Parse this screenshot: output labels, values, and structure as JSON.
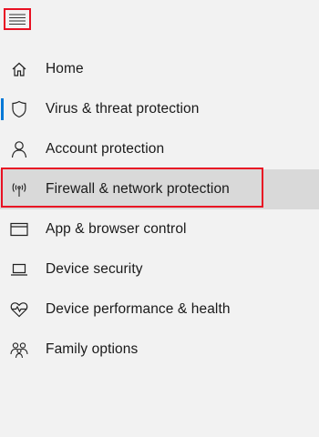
{
  "header": {
    "menu_icon": "hamburger-menu-icon"
  },
  "nav": {
    "items": [
      {
        "label": "Home",
        "icon": "home-icon"
      },
      {
        "label": "Virus & threat protection",
        "icon": "shield-icon"
      },
      {
        "label": "Account protection",
        "icon": "person-icon"
      },
      {
        "label": "Firewall & network protection",
        "icon": "antenna-icon"
      },
      {
        "label": "App & browser control",
        "icon": "app-window-icon"
      },
      {
        "label": "Device security",
        "icon": "laptop-icon"
      },
      {
        "label": "Device performance & health",
        "icon": "heart-pulse-icon"
      },
      {
        "label": "Family options",
        "icon": "family-icon"
      }
    ]
  },
  "colors": {
    "accent": "#0078d7",
    "highlight_border": "#e81123",
    "selected_background": "#d9d9d9",
    "background": "#f2f2f2"
  }
}
